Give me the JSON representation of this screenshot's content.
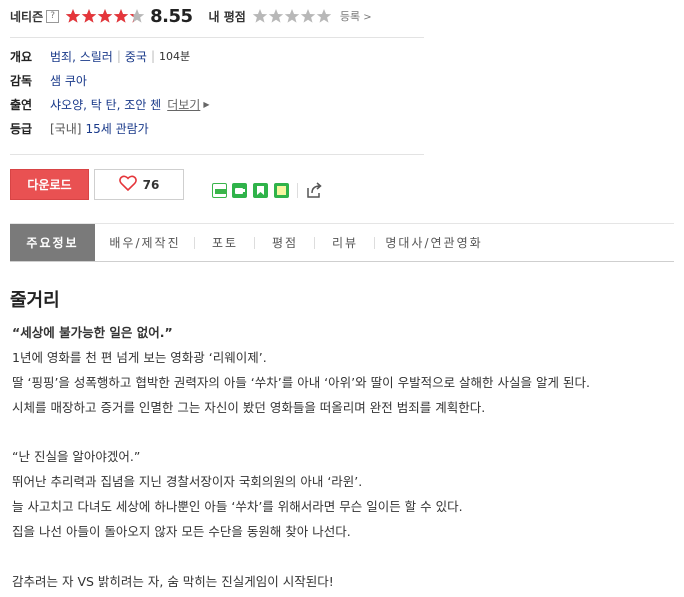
{
  "rating": {
    "netizen_label": "네티즌",
    "help_glyph": "?",
    "score": "8.55",
    "score_fill": 0.855,
    "my_rating_label": "내 평점",
    "register_label": "등록"
  },
  "info": {
    "overview_label": "개요",
    "genres": "범죄, 스릴러",
    "country": "중국",
    "runtime": "104분",
    "director_label": "감독",
    "director": "샘 쿠아",
    "cast_label": "출연",
    "cast": "샤오양, 탁 탄, 조안 첸",
    "more_label": "더보기",
    "grade_label": "등급",
    "grade_prefix": "[국내]",
    "grade": "15세 관람가"
  },
  "actions": {
    "download_label": "다운로드",
    "like_count": "76"
  },
  "tabs": [
    {
      "label": "주요정보",
      "active": true
    },
    {
      "label": "배우/제작진"
    },
    {
      "label": "포토"
    },
    {
      "label": "평점"
    },
    {
      "label": "리뷰"
    },
    {
      "label": "명대사/연관영화"
    }
  ],
  "synopsis": {
    "heading": "줄거리",
    "tagline": "“세상에 불가능한 일은 없어.”",
    "lines": [
      "1년에 영화를 천 편 넘게 보는 영화광 ‘리웨이제’.",
      "딸 ‘핑핑’을 성폭행하고 협박한 권력자의 아들 ‘쑤차’를 아내 ‘아위’와 딸이 우발적으로 살해한 사실을 알게 된다.",
      "시체를 매장하고 증거를 인멸한 그는 자신이 봤던 영화들을 떠올리며 완전 범죄를 계획한다.",
      "“난 진실을 알아야겠어.”",
      "뛰어난 추리력과 집념을 지닌 경찰서장이자 국회의원의 아내 ‘라윈’.",
      "늘 사고치고 다녀도 세상에 하나뿐인 아들 ‘쑤차’를 위해서라면 무슨 일이든 할 수 있다.",
      "집을 나선 아들이 돌아오지 않자 모든 수단을 동원해 찾아 나선다.",
      "감추려는 자 VS 밝히려는 자, 숨 막히는 진실게임이 시작된다!"
    ]
  },
  "colors": {
    "accent_red": "#e95152",
    "star_red": "#e5363b",
    "star_grey": "#b8b8b8",
    "tab_active": "#7a7a7a",
    "link_blue": "#1a3a8a"
  }
}
